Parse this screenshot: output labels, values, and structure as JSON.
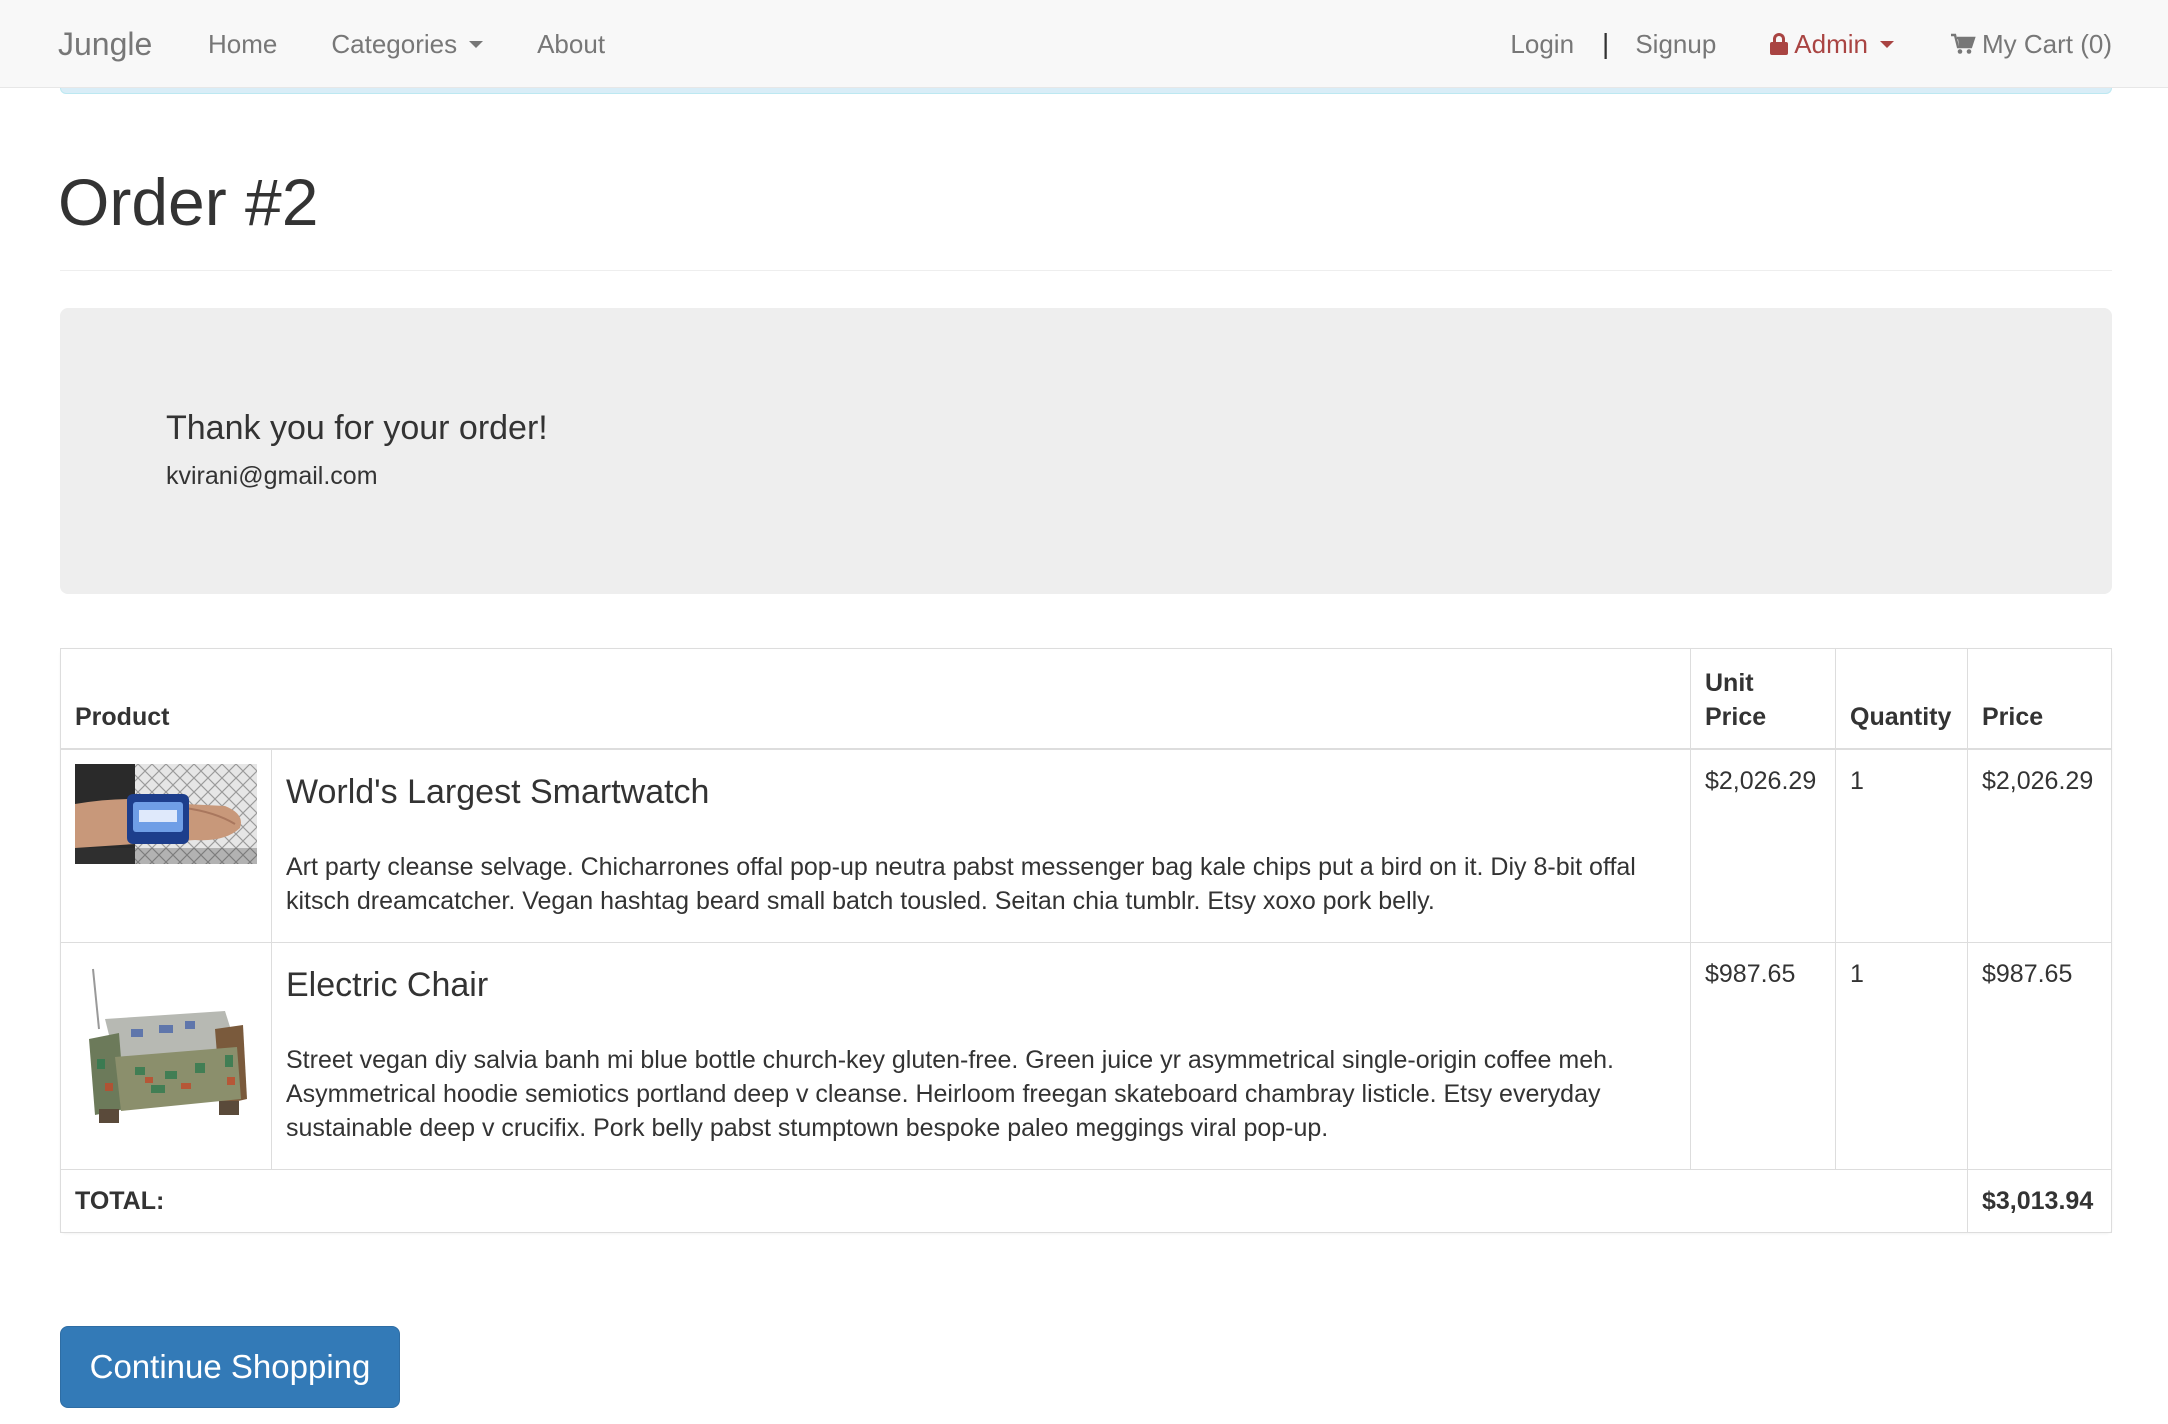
{
  "navbar": {
    "brand": "Jungle",
    "left_links": [
      {
        "label": "Home"
      },
      {
        "label": "Categories"
      },
      {
        "label": "About"
      }
    ],
    "login": "Login",
    "separator": "|",
    "signup": "Signup",
    "admin": "Admin",
    "cart": "My Cart (0)",
    "admin_color": "#a94442"
  },
  "page": {
    "title": "Order #2"
  },
  "confirmation": {
    "message": "Thank you for your order!",
    "email": "kvirani@gmail.com"
  },
  "table": {
    "headers": {
      "product": "Product",
      "unit_price": "Unit Price",
      "quantity": "Quantity",
      "price": "Price"
    },
    "rows": [
      {
        "name": "World's Largest Smartwatch",
        "description": "Art party cleanse selvage. Chicharrones offal pop-up neutra pabst messenger bag kale chips put a bird on it. Diy 8-bit offal kitsch dreamcatcher. Vegan hashtag beard small batch tousled. Seitan chia tumblr. Etsy xoxo pork belly.",
        "unit_price": "$2,026.29",
        "quantity": "1",
        "price": "$2,026.29",
        "image_icon": "smartwatch-image"
      },
      {
        "name": "Electric Chair",
        "description": "Street vegan diy salvia banh mi blue bottle church-key gluten-free. Green juice yr asymmetrical single-origin coffee meh. Asymmetrical hoodie semiotics portland deep v cleanse. Heirloom freegan skateboard chambray listicle. Etsy everyday sustainable deep v crucifix. Pork belly pabst stumptown bespoke paleo meggings viral pop-up.",
        "unit_price": "$987.65",
        "quantity": "1",
        "price": "$987.65",
        "image_icon": "electric-chair-image"
      }
    ],
    "total_label": "TOTAL:",
    "total_value": "$3,013.94"
  },
  "actions": {
    "continue_label": "Continue Shopping",
    "button_color": "#337ab7"
  }
}
